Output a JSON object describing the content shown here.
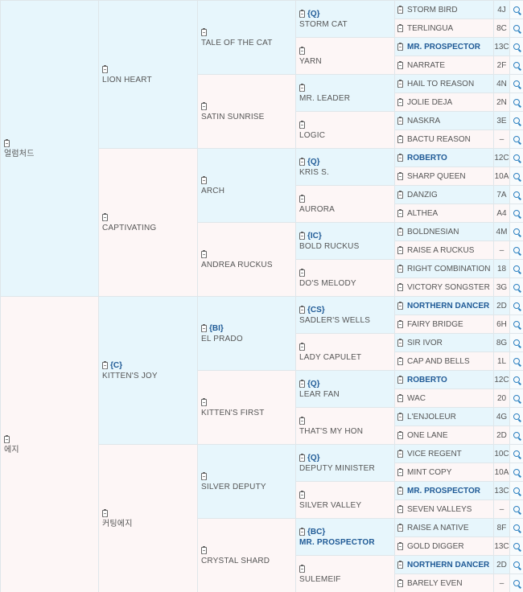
{
  "pedigree": {
    "gen1": [
      {
        "name": "얼럼처드",
        "code": "",
        "bold": false
      },
      {
        "name": "에지",
        "code": "",
        "bold": false
      }
    ],
    "gen2": [
      {
        "name": "LION HEART",
        "code": "",
        "bold": false
      },
      {
        "name": "CAPTIVATING",
        "code": "",
        "bold": false
      },
      {
        "name": "KITTEN'S JOY",
        "code": "{C}",
        "bold": false
      },
      {
        "name": "커팅에지",
        "code": "",
        "bold": false
      }
    ],
    "gen3": [
      {
        "name": "TALE OF THE CAT",
        "code": "",
        "bold": false
      },
      {
        "name": "SATIN SUNRISE",
        "code": "",
        "bold": false
      },
      {
        "name": "ARCH",
        "code": "",
        "bold": false
      },
      {
        "name": "ANDREA RUCKUS",
        "code": "",
        "bold": false
      },
      {
        "name": "EL PRADO",
        "code": "{BI}",
        "bold": false
      },
      {
        "name": "KITTEN'S FIRST",
        "code": "",
        "bold": false
      },
      {
        "name": "SILVER DEPUTY",
        "code": "",
        "bold": false
      },
      {
        "name": "CRYSTAL SHARD",
        "code": "",
        "bold": false
      }
    ],
    "gen4": [
      {
        "name": "STORM CAT",
        "code": "{Q}",
        "bold": false
      },
      {
        "name": "YARN",
        "code": "",
        "bold": false
      },
      {
        "name": "MR. LEADER",
        "code": "",
        "bold": false
      },
      {
        "name": "LOGIC",
        "code": "",
        "bold": false
      },
      {
        "name": "KRIS S.",
        "code": "{Q}",
        "bold": false
      },
      {
        "name": "AURORA",
        "code": "",
        "bold": false
      },
      {
        "name": "BOLD RUCKUS",
        "code": "{IC}",
        "bold": false
      },
      {
        "name": "DO'S MELODY",
        "code": "",
        "bold": false
      },
      {
        "name": "SADLER'S WELLS",
        "code": "{CS}",
        "bold": false
      },
      {
        "name": "LADY CAPULET",
        "code": "",
        "bold": false
      },
      {
        "name": "LEAR FAN",
        "code": "{Q}",
        "bold": false
      },
      {
        "name": "THAT'S MY HON",
        "code": "",
        "bold": false
      },
      {
        "name": "DEPUTY MINISTER",
        "code": "{Q}",
        "bold": false
      },
      {
        "name": "SILVER VALLEY",
        "code": "",
        "bold": false
      },
      {
        "name": "MR. PROSPECTOR",
        "code": "{BC}",
        "bold": true
      },
      {
        "name": "SULEMEIF",
        "code": "",
        "bold": false
      }
    ],
    "gen5": [
      {
        "name": "STORM BIRD",
        "bold": false,
        "rank": "4J"
      },
      {
        "name": "TERLINGUA",
        "bold": false,
        "rank": "8C"
      },
      {
        "name": "MR. PROSPECTOR",
        "bold": true,
        "rank": "13C"
      },
      {
        "name": "NARRATE",
        "bold": false,
        "rank": "2F"
      },
      {
        "name": "HAIL TO REASON",
        "bold": false,
        "rank": "4N"
      },
      {
        "name": "JOLIE DEJA",
        "bold": false,
        "rank": "2N"
      },
      {
        "name": "NASKRA",
        "bold": false,
        "rank": "3E"
      },
      {
        "name": "BACTU REASON",
        "bold": false,
        "rank": "–"
      },
      {
        "name": "ROBERTO",
        "bold": true,
        "rank": "12C"
      },
      {
        "name": "SHARP QUEEN",
        "bold": false,
        "rank": "10A"
      },
      {
        "name": "DANZIG",
        "bold": false,
        "rank": "7A"
      },
      {
        "name": "ALTHEA",
        "bold": false,
        "rank": "A4"
      },
      {
        "name": "BOLDNESIAN",
        "bold": false,
        "rank": "4M"
      },
      {
        "name": "RAISE A RUCKUS",
        "bold": false,
        "rank": "–"
      },
      {
        "name": "RIGHT COMBINATION",
        "bold": false,
        "rank": "18"
      },
      {
        "name": "VICTORY SONGSTER",
        "bold": false,
        "rank": "3G"
      },
      {
        "name": "NORTHERN DANCER",
        "bold": true,
        "rank": "2D"
      },
      {
        "name": "FAIRY BRIDGE",
        "bold": false,
        "rank": "6H"
      },
      {
        "name": "SIR IVOR",
        "bold": false,
        "rank": "8G"
      },
      {
        "name": "CAP AND BELLS",
        "bold": false,
        "rank": "1L"
      },
      {
        "name": "ROBERTO",
        "bold": true,
        "rank": "12C"
      },
      {
        "name": "WAC",
        "bold": false,
        "rank": "20"
      },
      {
        "name": "L'ENJOLEUR",
        "bold": false,
        "rank": "4G"
      },
      {
        "name": "ONE LANE",
        "bold": false,
        "rank": "2D"
      },
      {
        "name": "VICE REGENT",
        "bold": false,
        "rank": "10C"
      },
      {
        "name": "MINT COPY",
        "bold": false,
        "rank": "10A"
      },
      {
        "name": "MR. PROSPECTOR",
        "bold": true,
        "rank": "13C"
      },
      {
        "name": "SEVEN VALLEYS",
        "bold": false,
        "rank": "–"
      },
      {
        "name": "RAISE A NATIVE",
        "bold": false,
        "rank": "8F"
      },
      {
        "name": "GOLD DIGGER",
        "bold": false,
        "rank": "13C"
      },
      {
        "name": "NORTHERN DANCER",
        "bold": true,
        "rank": "2D"
      },
      {
        "name": "BARELY EVEN",
        "bold": false,
        "rank": "–"
      }
    ]
  },
  "colors": {
    "male_bg": "#e7f6fc",
    "female_bg": "#fdf6f6",
    "link": "#1f5a96",
    "icon": "#2a7fc0"
  },
  "icons": {
    "detail": "clipboard-icon",
    "search": "magnifier-icon"
  }
}
